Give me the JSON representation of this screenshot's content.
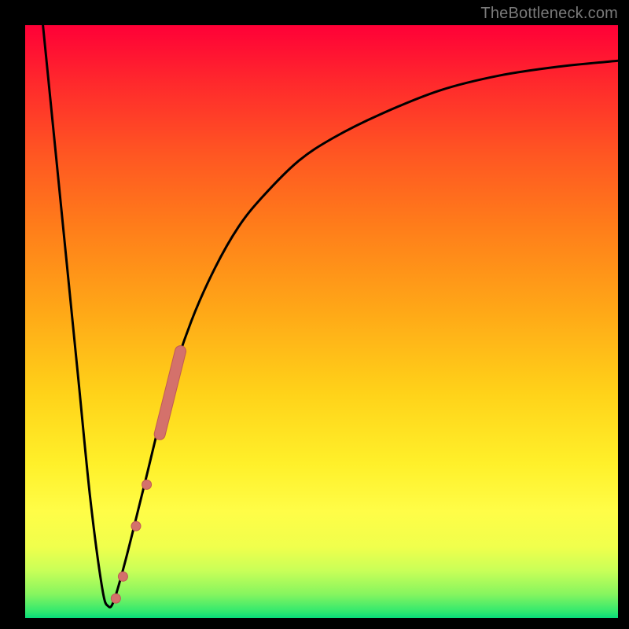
{
  "attribution": "TheBottleneck.com",
  "colors": {
    "frame": "#000000",
    "curve": "#000000",
    "marker_fill": "#d4716b",
    "marker_stroke": "#bf5a54"
  },
  "chart_data": {
    "type": "line",
    "title": "",
    "xlabel": "",
    "ylabel": "",
    "xlim": [
      0,
      100
    ],
    "ylim": [
      0,
      100
    ],
    "series": [
      {
        "name": "bottleneck-curve",
        "x": [
          3,
          5,
          7,
          9,
          11,
          13,
          14,
          15,
          17,
          20,
          24,
          28,
          32,
          36,
          40,
          46,
          52,
          60,
          70,
          80,
          90,
          100
        ],
        "y": [
          100,
          80,
          60,
          40,
          20,
          5,
          2,
          3,
          10,
          22,
          38,
          50,
          59,
          66,
          71,
          77,
          81,
          85,
          89,
          91.5,
          93,
          94
        ]
      }
    ],
    "markers": [
      {
        "shape": "segment",
        "x0": 22.7,
        "y0": 31.0,
        "x1": 26.2,
        "y1": 45.0,
        "width": 13
      },
      {
        "shape": "dot",
        "x": 20.5,
        "y": 22.5,
        "r": 6
      },
      {
        "shape": "dot",
        "x": 18.7,
        "y": 15.5,
        "r": 6
      },
      {
        "shape": "dot",
        "x": 16.5,
        "y": 7.0,
        "r": 6
      },
      {
        "shape": "dot",
        "x": 15.3,
        "y": 3.3,
        "r": 6
      }
    ]
  }
}
